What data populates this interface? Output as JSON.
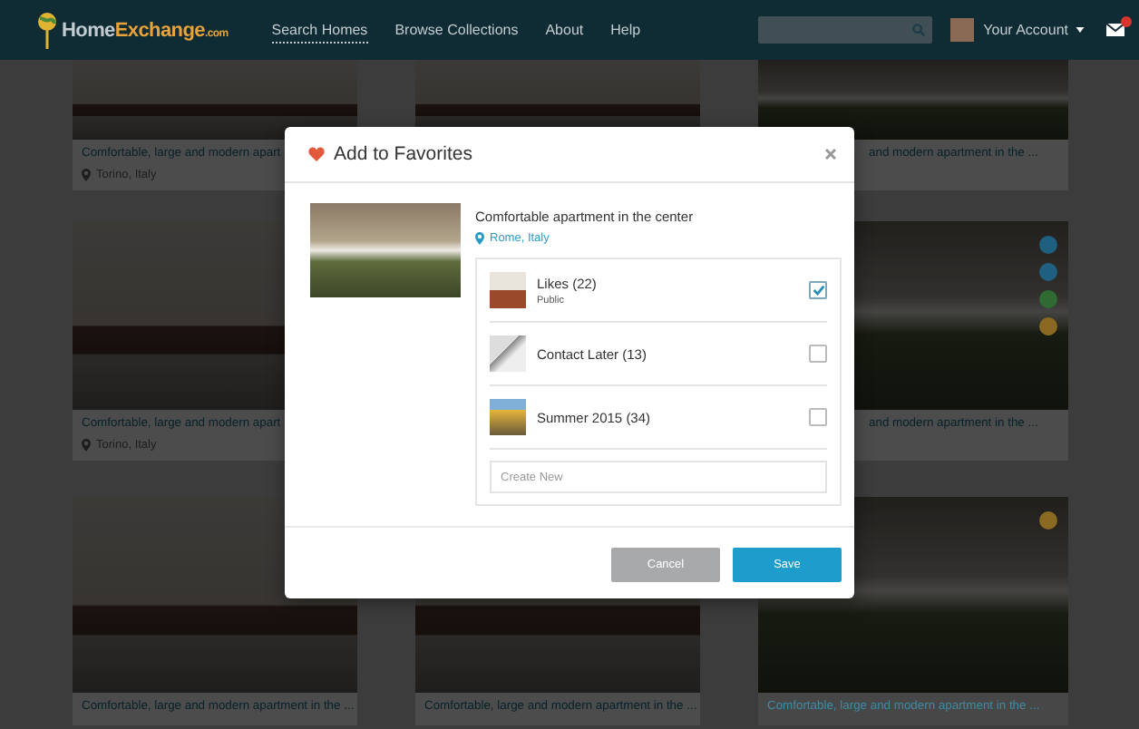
{
  "navbar": {
    "logo": {
      "part1": "Home",
      "part2": "Exchange",
      "suffix": ".com"
    },
    "links": [
      {
        "label": "Search Homes",
        "selected": true
      },
      {
        "label": "Browse Collections",
        "selected": false
      },
      {
        "label": "About",
        "selected": false
      },
      {
        "label": "Help",
        "selected": false
      }
    ],
    "account": "Your Account"
  },
  "listings": [
    {
      "kind": "listing",
      "title": "Comfortable, large and modern apart",
      "location": "Torino, Italy"
    },
    {
      "kind": "photo"
    },
    {
      "kind": "listing",
      "title": "and modern apartment in the ..."
    },
    {
      "kind": "listing",
      "title": "Comfortable, large and modern apart",
      "location": "Torino, Italy"
    },
    {
      "kind": "photo"
    },
    {
      "kind": "listing",
      "title": "and modern apartment in the ...",
      "badges": [
        {
          "color": "#1f5f80"
        },
        {
          "color": "#1f5f80"
        },
        {
          "color": "#2e6a32"
        },
        {
          "color": "#8a6a22"
        }
      ]
    },
    {
      "kind": "listing",
      "title": "Comfortable, large and modern apartment in the ..."
    },
    {
      "kind": "listing",
      "title": "Comfortable, large and modern apartment in the ..."
    },
    {
      "kind": "listing",
      "title": "Comfortable, large and modern apartment in the ...",
      "badges": [
        {
          "color": "#8a6a22"
        }
      ]
    }
  ],
  "modal": {
    "title": "Add to Favorites",
    "listing": {
      "title": "Comfortable apartment in the center",
      "location": "Rome, Italy"
    },
    "lists": [
      {
        "name": "Likes",
        "count": "(22)",
        "note": "Public",
        "checked": true
      },
      {
        "name": "Contact Later",
        "count": "(13)",
        "checked": false
      },
      {
        "name": "Summer 2015",
        "count": "(34)",
        "checked": false
      }
    ],
    "create_placeholder": "Create New",
    "buttons": [
      {
        "label": "Cancel",
        "kind": "secondary"
      },
      {
        "label": "Save",
        "kind": "primary"
      }
    ]
  }
}
